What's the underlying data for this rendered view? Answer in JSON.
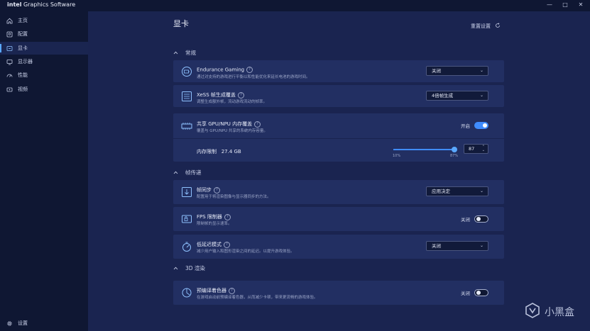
{
  "app": {
    "brand_bold": "intel",
    "brand_rest": "Graphics Software"
  },
  "window": {
    "minimize": "—",
    "maximize": "□",
    "close": "✕"
  },
  "sidebar": {
    "items": [
      {
        "label": "主页",
        "icon": "home-icon"
      },
      {
        "label": "配置",
        "icon": "profile-icon"
      },
      {
        "label": "显卡",
        "icon": "graphics-icon",
        "active": true
      },
      {
        "label": "显示器",
        "icon": "display-icon"
      },
      {
        "label": "性能",
        "icon": "performance-icon"
      },
      {
        "label": "视频",
        "icon": "video-icon"
      }
    ],
    "settings_label": "设置"
  },
  "main": {
    "title": "显卡",
    "reset_label": "重置设置"
  },
  "sections": {
    "general": "常规",
    "frame": "帧传递",
    "render3d": "3D 渲染"
  },
  "rows": {
    "endurance": {
      "title": "Endurance Gaming",
      "desc": "通过对支持的游戏进行平衡以和性能优化来延长电池的游戏时间。",
      "value": "关闭"
    },
    "xess": {
      "title": "XeSS 帧生成覆盖",
      "desc": "调整生成额外帧，流动游戏流动的帧率。",
      "value": "4倍帧生成"
    },
    "shared": {
      "title": "共享 GPU/NPU 内存覆盖",
      "desc": "覆盖与 GPU/NPU 共享的系统内存容量。",
      "state": "开启"
    },
    "memory": {
      "label": "内存限制",
      "amount": "27.4 GB",
      "min_label": "10%",
      "max_label": "87%",
      "value": "87",
      "fill_fraction": 1.0
    },
    "vsync": {
      "title": "帧同步",
      "desc": "配置用于将渲染图像与显示器同步的方法。",
      "value": "应用决定"
    },
    "fps": {
      "title": "FPS 限制器",
      "desc": "限制帧的显示速率。",
      "state": "关闭"
    },
    "lowlat": {
      "title": "低延迟模式",
      "desc": "减少用户输入和图形渲染之间的延迟。以提升游戏体验。",
      "value": "关闭"
    },
    "shader": {
      "title": "预编译着色器",
      "desc": "在游戏启动前预编译着色器，从而减少卡顿，带来更流畅的游戏体验。",
      "state": "关闭"
    }
  },
  "watermark": {
    "text": "小黑盒"
  }
}
